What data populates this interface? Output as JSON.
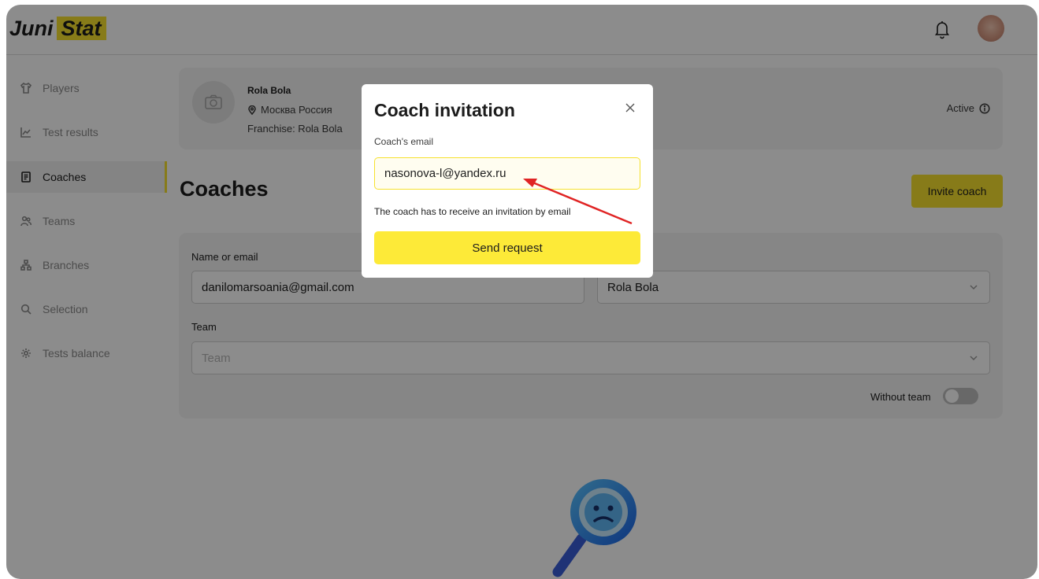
{
  "header": {
    "logo_part1": "Juni",
    "logo_part2": "Stat",
    "notifications_icon": "bell-icon",
    "avatar_icon": "user-avatar"
  },
  "sidebar": {
    "items": [
      {
        "label": "Players",
        "icon": "shirt-icon",
        "active": false
      },
      {
        "label": "Test results",
        "icon": "chart-icon",
        "active": false
      },
      {
        "label": "Coaches",
        "icon": "document-icon",
        "active": true
      },
      {
        "label": "Teams",
        "icon": "people-icon",
        "active": false
      },
      {
        "label": "Branches",
        "icon": "hierarchy-icon",
        "active": false
      },
      {
        "label": "Selection",
        "icon": "search-icon",
        "active": false
      },
      {
        "label": "Tests balance",
        "icon": "gear-icon",
        "active": false
      }
    ]
  },
  "profile": {
    "name": "Rola Bola",
    "location": "Москва Россия",
    "franchise": "Franchise: Rola Bola",
    "status": "Active"
  },
  "page": {
    "title": "Coaches",
    "invite_button": "Invite coach"
  },
  "filters": {
    "name_label": "Name or email",
    "name_value": "danilomarsoania@gmail.com",
    "branch_value": "Rola Bola",
    "team_label": "Team",
    "team_placeholder": "Team",
    "without_team_label": "Without team",
    "without_team_on": false
  },
  "modal": {
    "title": "Coach invitation",
    "email_label": "Coach's email",
    "email_value": "nasonova-l@yandex.ru",
    "hint": "The coach has to receive an invitation by email",
    "submit_button": "Send request"
  },
  "colors": {
    "accent": "#f6e12e",
    "overlay": "rgba(0,0,0,0.45)",
    "annotation_arrow": "#e02424"
  }
}
